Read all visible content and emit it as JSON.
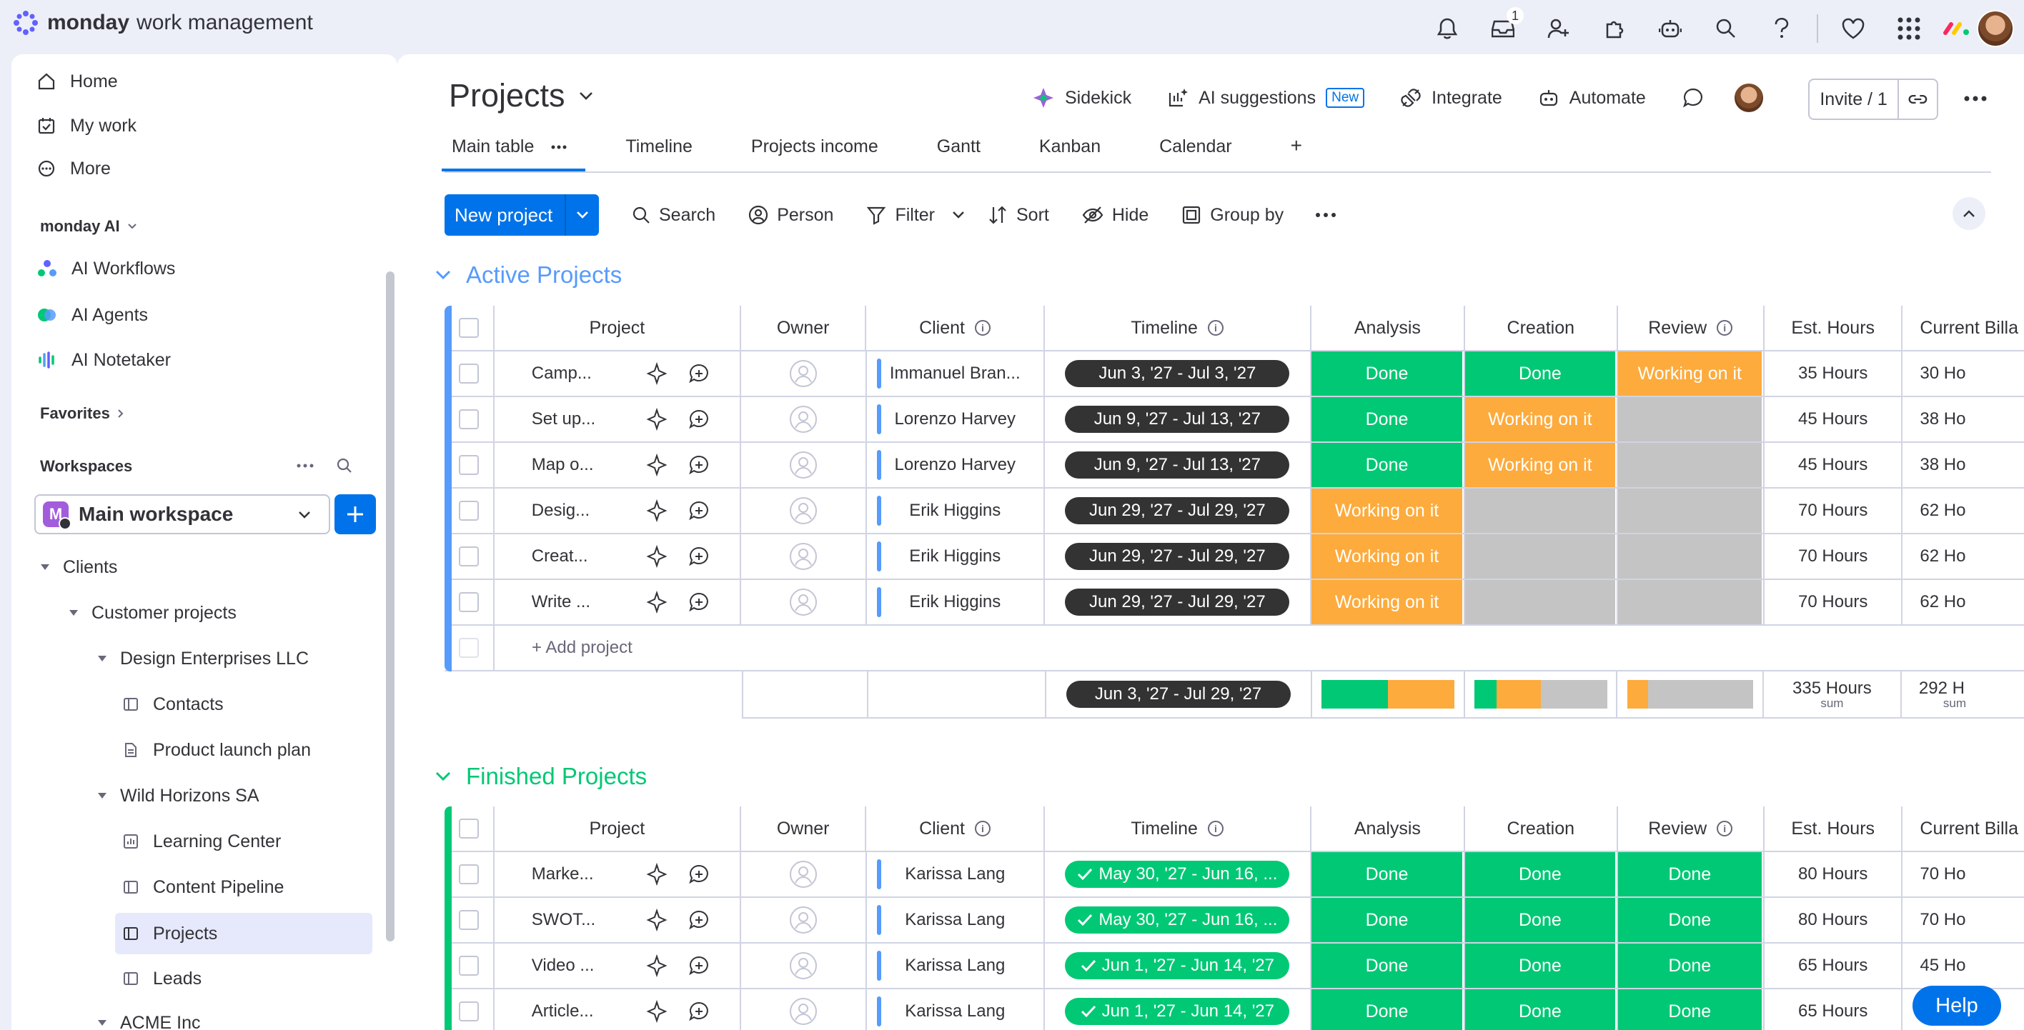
{
  "app": {
    "brand": "monday",
    "product": "work management"
  },
  "topbar": {
    "inbox_badge": "1"
  },
  "sidebar": {
    "nav": [
      {
        "label": "Home",
        "icon": "home-icon"
      },
      {
        "label": "My work",
        "icon": "calendar-check-icon"
      },
      {
        "label": "More",
        "icon": "more-icon"
      }
    ],
    "ai_section": "monday AI",
    "ai_items": [
      "AI Workflows",
      "AI Agents",
      "AI Notetaker"
    ],
    "favorites": "Favorites",
    "workspaces": "Workspaces",
    "workspace_badge": "M",
    "workspace_name": "Main workspace",
    "tree": [
      {
        "label": "Clients",
        "type": "folder"
      },
      {
        "label": "Customer projects",
        "type": "folder"
      },
      {
        "label": "Design Enterprises LLC",
        "type": "folder"
      },
      {
        "label": "Contacts",
        "type": "board"
      },
      {
        "label": "Product launch plan",
        "type": "doc"
      },
      {
        "label": "Wild Horizons SA",
        "type": "folder"
      },
      {
        "label": "Learning Center",
        "type": "dashboard"
      },
      {
        "label": "Content Pipeline",
        "type": "board"
      },
      {
        "label": "Projects",
        "type": "board"
      },
      {
        "label": "Leads",
        "type": "board"
      },
      {
        "label": "ACME Inc",
        "type": "folder"
      }
    ]
  },
  "board": {
    "title": "Projects",
    "actions": {
      "sidekick": "Sidekick",
      "ai_suggestions": "AI suggestions",
      "new_tag": "New",
      "integrate": "Integrate",
      "automate": "Automate",
      "invite": "Invite / 1"
    },
    "tabs": [
      "Main table",
      "Timeline",
      "Projects income",
      "Gantt",
      "Kanban",
      "Calendar",
      "+"
    ],
    "toolbar": {
      "new_item": "New project",
      "search": "Search",
      "person": "Person",
      "filter": "Filter",
      "sort": "Sort",
      "hide": "Hide",
      "group_by": "Group by"
    },
    "columns": {
      "project": "Project",
      "owner": "Owner",
      "client": "Client",
      "timeline": "Timeline",
      "analysis": "Analysis",
      "creation": "Creation",
      "review": "Review",
      "est_hours": "Est. Hours",
      "current": "Current Billa"
    },
    "groups": [
      {
        "title": "Active Projects",
        "color": "#579bfc",
        "rows": [
          {
            "name": "Camp...",
            "client": "Immanuel Bran...",
            "timeline": "Jun 3, '27 - Jul 3, '27",
            "done": false,
            "analysis": "Done",
            "creation": "Done",
            "review": "Working on it",
            "est": "35 Hours",
            "cur": "30 Ho"
          },
          {
            "name": "Set up...",
            "client": "Lorenzo Harvey",
            "timeline": "Jun 9, '27 - Jul 13, '27",
            "done": false,
            "analysis": "Done",
            "creation": "Working on it",
            "review": "",
            "est": "45 Hours",
            "cur": "38 Ho"
          },
          {
            "name": "Map o...",
            "client": "Lorenzo Harvey",
            "timeline": "Jun 9, '27 - Jul 13, '27",
            "done": false,
            "analysis": "Done",
            "creation": "Working on it",
            "review": "",
            "est": "45 Hours",
            "cur": "38 Ho"
          },
          {
            "name": "Desig...",
            "client": "Erik Higgins",
            "timeline": "Jun 29, '27 - Jul 29, '27",
            "done": false,
            "analysis": "Working on it",
            "creation": "",
            "review": "",
            "est": "70 Hours",
            "cur": "62 Ho"
          },
          {
            "name": "Creat...",
            "client": "Erik Higgins",
            "timeline": "Jun 29, '27 - Jul 29, '27",
            "done": false,
            "analysis": "Working on it",
            "creation": "",
            "review": "",
            "est": "70 Hours",
            "cur": "62 Ho"
          },
          {
            "name": "Write ...",
            "client": "Erik Higgins",
            "timeline": "Jun 29, '27 - Jul 29, '27",
            "done": false,
            "analysis": "Working on it",
            "creation": "",
            "review": "",
            "est": "70 Hours",
            "cur": "62 Ho"
          }
        ],
        "add_label": "+ Add project",
        "summary": {
          "timeline": "Jun 3, '27 - Jul 29, '27",
          "est": "335 Hours",
          "est_sub": "sum",
          "cur": "292 H",
          "cur_sub": "sum",
          "analysis_dist": {
            "done": 0.5,
            "working": 0.5,
            "empty": 0
          },
          "creation_dist": {
            "done": 0.17,
            "working": 0.33,
            "empty": 0.5
          },
          "review_dist": {
            "done": 0,
            "working": 0.17,
            "empty": 0.83
          }
        }
      },
      {
        "title": "Finished Projects",
        "color": "#00c875",
        "rows": [
          {
            "name": "Marke...",
            "client": "Karissa Lang",
            "timeline": "May 30, '27 - Jun 16, ...",
            "done": true,
            "analysis": "Done",
            "creation": "Done",
            "review": "Done",
            "est": "80 Hours",
            "cur": "70 Ho"
          },
          {
            "name": "SWOT...",
            "client": "Karissa Lang",
            "timeline": "May 30, '27 - Jun 16, ...",
            "done": true,
            "analysis": "Done",
            "creation": "Done",
            "review": "Done",
            "est": "80 Hours",
            "cur": "70 Ho"
          },
          {
            "name": "Video ...",
            "client": "Karissa Lang",
            "timeline": "Jun 1, '27 - Jun 14, '27",
            "done": true,
            "analysis": "Done",
            "creation": "Done",
            "review": "Done",
            "est": "65 Hours",
            "cur": "45 Ho"
          },
          {
            "name": "Article...",
            "client": "Karissa Lang",
            "timeline": "Jun 1, '27 - Jun 14, '27",
            "done": true,
            "analysis": "Done",
            "creation": "Done",
            "review": "Done",
            "est": "65 Hours",
            "cur": "55 Ho"
          }
        ]
      }
    ]
  },
  "help": "Help",
  "colors": {
    "done": "#00c875",
    "working": "#fdab3d",
    "empty": "#c4c4c4",
    "primary": "#0073ea"
  }
}
